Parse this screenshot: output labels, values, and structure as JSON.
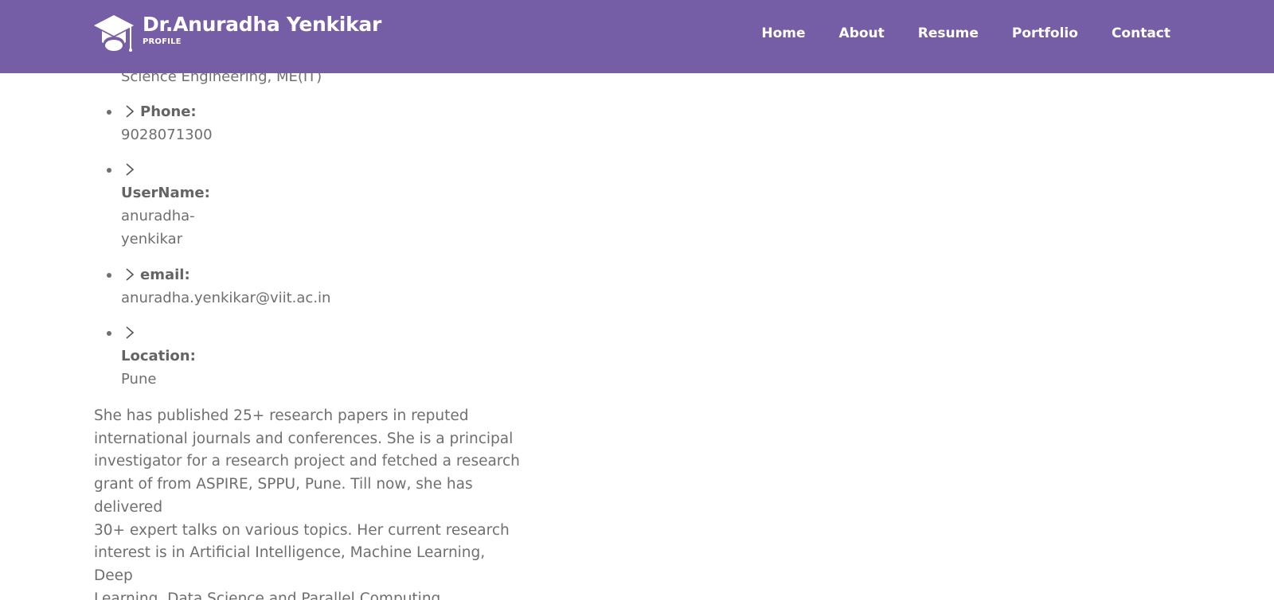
{
  "brand": {
    "title": "Dr.Anuradha Yenkikar",
    "subtitle": "PROFILE",
    "logo_icon": "graduation-cap-icon"
  },
  "nav": {
    "items": [
      {
        "label": "Home"
      },
      {
        "label": "About"
      },
      {
        "label": "Resume"
      },
      {
        "label": "Portfolio"
      },
      {
        "label": "Contact"
      }
    ]
  },
  "info": {
    "partial_text": "Science Engineering, ME(IT)",
    "phone": {
      "label": "Phone:",
      "value": "9028071300"
    },
    "username": {
      "label": "UserName:",
      "value_line1": "anuradha-",
      "value_line2": "yenkikar"
    },
    "email": {
      "label": "email:",
      "value": "anuradha.yenkikar@viit.ac.in"
    },
    "location": {
      "label": "Location:",
      "value": "Pune"
    },
    "chevron_icon": "chevron-right-icon"
  },
  "bio": {
    "line1": "She has published 25+ research papers in reputed",
    "line2": "international journals and conferences. She is a principal",
    "line3": "investigator for a research project and fetched a research",
    "line4": "grant of from ASPIRE, SPPU, Pune. Till now, she has delivered",
    "line5": "30+ expert talks on various topics. Her current research",
    "line6": "interest is in Artificial Intelligence, Machine Learning, Deep",
    "line7": "Learning, Data Science and Parallel Computing"
  },
  "colors": {
    "header_bg": "#765ea6",
    "header_text": "#ffffff",
    "body_text": "#6f6f6f"
  }
}
